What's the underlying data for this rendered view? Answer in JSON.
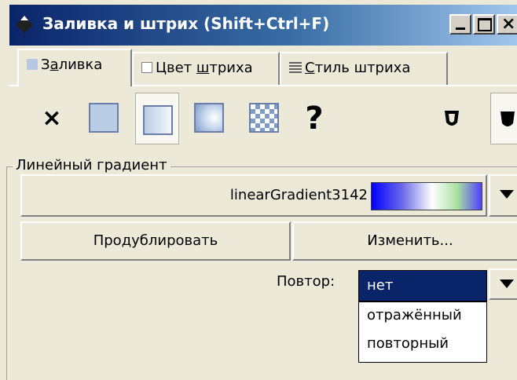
{
  "window": {
    "title": "Заливка и штрих (Shift+Ctrl+F)"
  },
  "title_buttons": {
    "close_glyph": "×"
  },
  "tabs": [
    {
      "label_pre": "З",
      "label_ul": "а",
      "label_post": "ливка",
      "icon": "fill-icon",
      "active": true
    },
    {
      "label_pre": "Цвет ",
      "label_ul": "ш",
      "label_post": "триха",
      "icon": "stroke-paint-icon",
      "active": false
    },
    {
      "label_pre": "",
      "label_ul": "С",
      "label_post": "тиль штриха",
      "icon": "stroke-style-icon",
      "active": false
    }
  ],
  "paint_modes": {
    "none_glyph": "×",
    "unset_glyph": "?",
    "selected": "linear-gradient"
  },
  "gradient_section": {
    "label": "Линейный градиент",
    "gradient_name": "linearGradient3142",
    "duplicate_label": "Продублировать",
    "edit_label": "Изменить..."
  },
  "repeat": {
    "label": "Повтор:",
    "selected": "нет",
    "options": [
      "отражённый",
      "повторный"
    ]
  },
  "colors": {
    "titlebar_start": "#0a246a",
    "titlebar_end": "#a6caf0",
    "selection": "#0a246a",
    "panel_bg": "#ece9d8"
  }
}
